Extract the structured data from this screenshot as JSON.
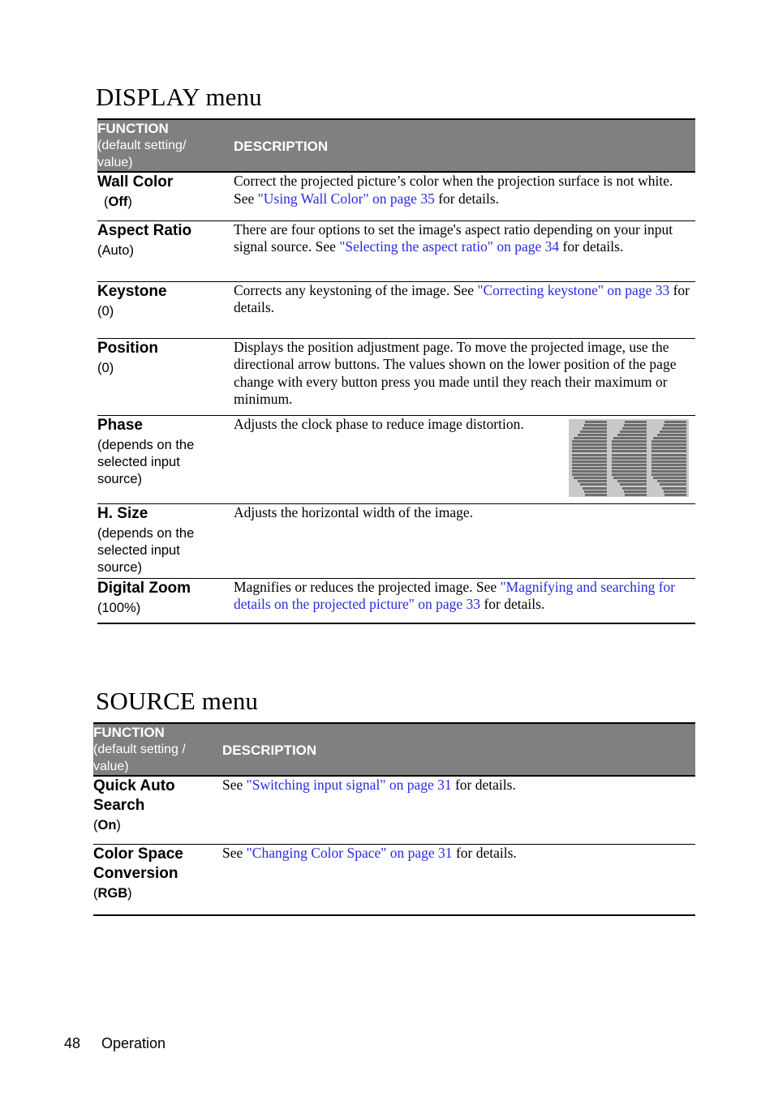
{
  "page": {
    "footer_page_number": "48",
    "footer_section": "Operation",
    "link_color": "#2a2ae0",
    "header_bg_color": "#808080",
    "header_text_color": "#ffffff"
  },
  "display_menu": {
    "title": "DISPLAY menu",
    "header": {
      "function_label": "FUNCTION",
      "function_sublabel": "(default setting/\nvalue)",
      "description_label": "DESCRIPTION"
    },
    "rows": [
      {
        "name": "Wall Color",
        "default_open": "(",
        "default_value": "Off",
        "default_close": ")",
        "default_bold": true,
        "default_indent": true,
        "description_parts": [
          {
            "text": "Correct the projected picture’s color when the projection surface is not white. See ",
            "link": false
          },
          {
            "text": "\"Using Wall Color\" on page 35",
            "link": true
          },
          {
            "text": " for details.",
            "link": false
          }
        ]
      },
      {
        "name": "Aspect Ratio",
        "default_open": "(",
        "default_value": "Auto",
        "default_close": ")",
        "default_bold": false,
        "default_indent": false,
        "description_parts": [
          {
            "text": "There are four options to set the image's aspect ratio depending on your input signal source. See ",
            "link": false
          },
          {
            "text": "\"Selecting the aspect ratio\" on page 34",
            "link": true
          },
          {
            "text": " for details.",
            "link": false
          }
        ]
      },
      {
        "name": "Keystone",
        "default_open": "(",
        "default_value": "0",
        "default_close": ")",
        "default_bold": false,
        "default_indent": false,
        "description_parts": [
          {
            "text": "Corrects any keystoning of the image. See ",
            "link": false
          },
          {
            "text": "\"Correcting keystone\" on page 33",
            "link": true
          },
          {
            "text": " for details.",
            "link": false
          }
        ]
      },
      {
        "name": "Position",
        "default_open": "(",
        "default_value": "0",
        "default_close": ")",
        "default_bold": false,
        "default_indent": false,
        "description_parts": [
          {
            "text": "Displays the position adjustment page. To move the projected image, use the directional arrow buttons. The values shown on the lower position of the page change with every button press you made until they reach their maximum or minimum.",
            "link": false
          }
        ]
      },
      {
        "name": "Phase",
        "default_open": "(",
        "default_value": "depends on the\nselected input\nsource",
        "default_close": ")",
        "default_bold": false,
        "default_indent": false,
        "has_thumbnail": true,
        "thumbnail_name": "phase-pattern-image",
        "description_parts": [
          {
            "text": "Adjusts the clock phase to reduce image distortion.",
            "link": false
          }
        ]
      },
      {
        "name": "H. Size",
        "default_open": "(",
        "default_value": "depends on the\nselected input\nsource",
        "default_close": ")",
        "default_bold": false,
        "default_indent": false,
        "description_parts": [
          {
            "text": "Adjusts the horizontal width of the image.",
            "link": false
          }
        ]
      },
      {
        "name": "Digital Zoom",
        "default_open": "(",
        "default_value": "100%",
        "default_close": ")",
        "default_bold": false,
        "default_indent": false,
        "description_parts": [
          {
            "text": "Magnifies or reduces the projected image. See ",
            "link": false
          },
          {
            "text": "\"Magnifying and searching for details on the projected picture\" on page 33",
            "link": true
          },
          {
            "text": " for details.",
            "link": false
          }
        ]
      }
    ]
  },
  "source_menu": {
    "title": "SOURCE menu",
    "header": {
      "function_label": "FUNCTION",
      "function_sublabel": "(default setting /\nvalue)",
      "description_label": "DESCRIPTION"
    },
    "rows": [
      {
        "name": "Quick Auto\nSearch",
        "default_open": "(",
        "default_value": "On",
        "default_close": ")",
        "default_bold": true,
        "default_indent": false,
        "description_parts": [
          {
            "text": "See ",
            "link": false
          },
          {
            "text": "\"Switching input signal\" on page 31",
            "link": true
          },
          {
            "text": " for details.",
            "link": false
          }
        ]
      },
      {
        "name": "Color Space\nConversion",
        "default_open": "(",
        "default_value": "RGB",
        "default_close": ")",
        "default_bold": true,
        "default_indent": false,
        "description_parts": [
          {
            "text": "See ",
            "link": false
          },
          {
            "text": "\"Changing Color Space\" on page 31",
            "link": true
          },
          {
            "text": " for details.",
            "link": false
          }
        ]
      }
    ]
  }
}
